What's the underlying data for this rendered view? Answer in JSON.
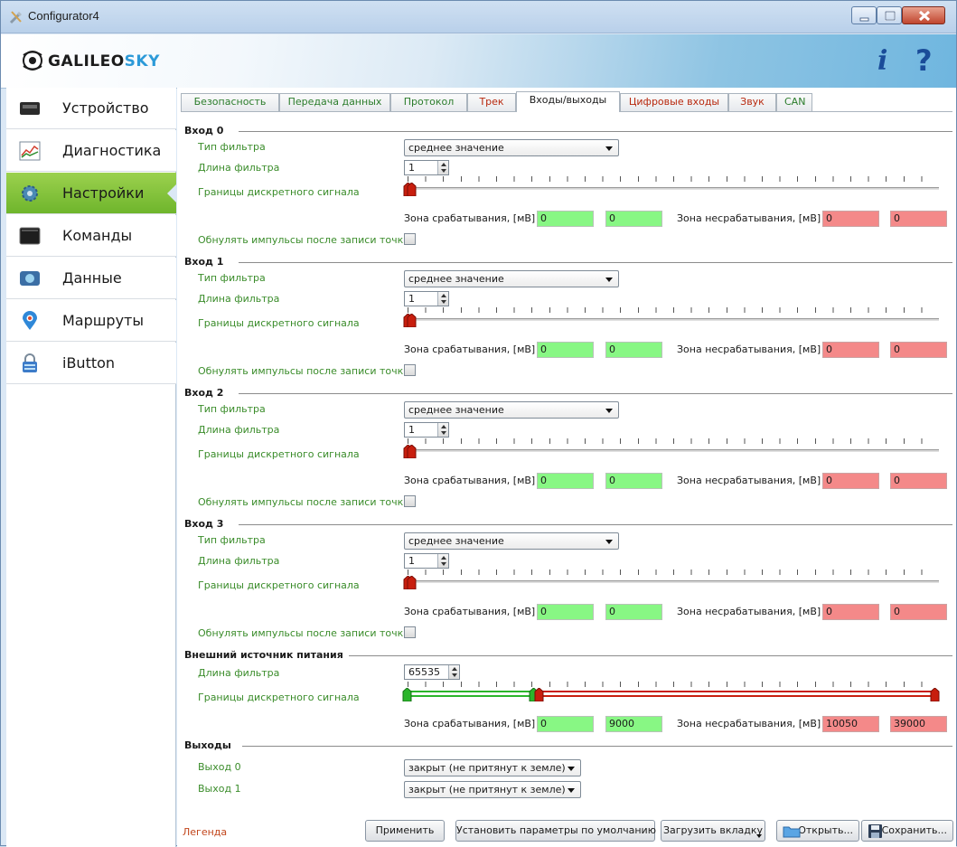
{
  "window": {
    "title": "Configurator4"
  },
  "header": {
    "logo_text": "GALILEOSKY",
    "logo_prefix": "GALILEO",
    "logo_suffix": "SKY",
    "info_icon": "i",
    "help_icon": "?"
  },
  "sidebar": {
    "items": [
      {
        "label": "Устройство",
        "icon": "device-icon",
        "active": false
      },
      {
        "label": "Диагностика",
        "icon": "diagnostics-chart-icon",
        "active": false
      },
      {
        "label": "Настройки",
        "icon": "settings-gear-icon",
        "active": true
      },
      {
        "label": "Команды",
        "icon": "terminal-icon",
        "active": false
      },
      {
        "label": "Данные",
        "icon": "data-icon",
        "active": false
      },
      {
        "label": "Маршруты",
        "icon": "map-pin-icon",
        "active": false
      },
      {
        "label": "iButton",
        "icon": "lock-icon",
        "active": false
      }
    ]
  },
  "tabs": [
    {
      "label": "Безопасность",
      "style": "green"
    },
    {
      "label": "Передача данных",
      "style": "green"
    },
    {
      "label": "Протокол",
      "style": "green"
    },
    {
      "label": "Трек",
      "style": "red"
    },
    {
      "label": "Входы/выходы",
      "style": "active"
    },
    {
      "label": "Цифровые входы",
      "style": "red"
    },
    {
      "label": "Звук",
      "style": "red"
    },
    {
      "label": "CAN",
      "style": "green"
    }
  ],
  "labels": {
    "filter_type": "Тип фильтра",
    "filter_length": "Длина фильтра",
    "bounds": "Границы дискретного сигнала",
    "on_zone": "Зона срабатывания, [мВ]",
    "off_zone": "Зона несрабатывания, [мВ]",
    "reset_pulses": "Обнулять импульсы после записи точки"
  },
  "inputs": [
    {
      "title": "Вход 0",
      "filter_type": "среднее значение",
      "filter_length": "1",
      "on_from": "0",
      "on_to": "0",
      "off_from": "0",
      "off_to": "0",
      "reset_checked": false
    },
    {
      "title": "Вход 1",
      "filter_type": "среднее значение",
      "filter_length": "1",
      "on_from": "0",
      "on_to": "0",
      "off_from": "0",
      "off_to": "0",
      "reset_checked": false
    },
    {
      "title": "Вход 2",
      "filter_type": "среднее значение",
      "filter_length": "1",
      "on_from": "0",
      "on_to": "0",
      "off_from": "0",
      "off_to": "0",
      "reset_checked": false
    },
    {
      "title": "Вход 3",
      "filter_type": "среднее значение",
      "filter_length": "1",
      "on_from": "0",
      "on_to": "0",
      "off_from": "0",
      "off_to": "0",
      "reset_checked": false
    }
  ],
  "power": {
    "title": "Внешний источник питания",
    "filter_length": "65535",
    "on_from": "0",
    "on_to": "9000",
    "off_from": "10050",
    "off_to": "39000"
  },
  "outputs": {
    "title": "Выходы",
    "items": [
      {
        "label": "Выход 0",
        "value": "закрыт (не притянут к земле)"
      },
      {
        "label": "Выход 1",
        "value": "закрыт (не притянут к земле)"
      }
    ]
  },
  "footer": {
    "legend": "Легенда",
    "apply": "Применить",
    "defaults": "Установить параметры по умолчанию",
    "load_tab": "Загрузить вкладку",
    "open": "Открыть...",
    "save": "Сохранить..."
  },
  "colors": {
    "accent_green": "#6fb52c",
    "zone_green": "#88f784",
    "zone_red": "#f48989",
    "label_green": "#3a8c2a"
  }
}
